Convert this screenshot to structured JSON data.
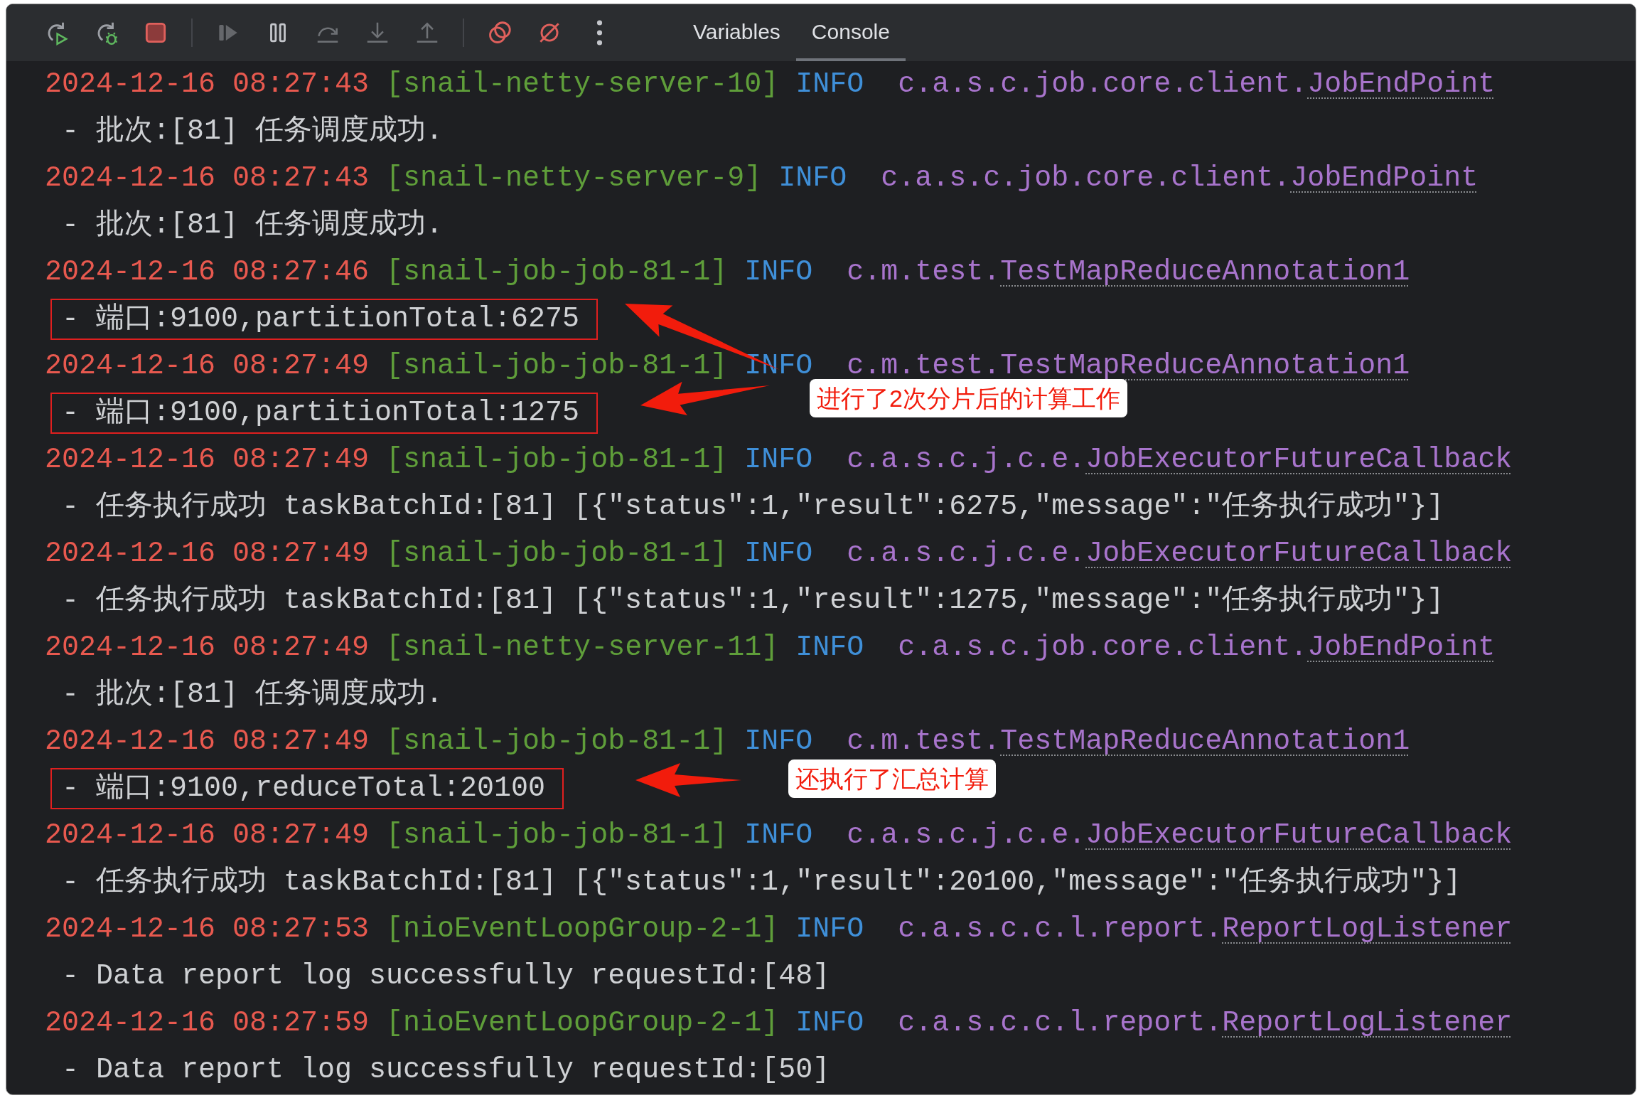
{
  "toolbar": [
    {
      "kind": "rerun",
      "disabled": false
    },
    {
      "kind": "rerun-debug",
      "disabled": false
    },
    {
      "kind": "stop",
      "disabled": false
    },
    {
      "kind": "divider"
    },
    {
      "kind": "resume",
      "disabled": true
    },
    {
      "kind": "pause",
      "disabled": false
    },
    {
      "kind": "step-over",
      "disabled": true
    },
    {
      "kind": "step-into",
      "disabled": true
    },
    {
      "kind": "step-out",
      "disabled": true
    },
    {
      "kind": "divider"
    },
    {
      "kind": "breakpoints",
      "disabled": false
    },
    {
      "kind": "mute",
      "disabled": false
    },
    {
      "kind": "more",
      "disabled": false
    }
  ],
  "tabs": [
    {
      "label": "Variables",
      "selected": false
    },
    {
      "label": "Console",
      "selected": true
    }
  ],
  "log": [
    {
      "time": "2024-12-16 08:27:43",
      "thread": "[snail-netty-server-10]",
      "level": "INFO",
      "logger_prefix": "c.a.s.c.job.core.client.",
      "logger_class": "JobEndPoint",
      "message": "- 批次:[81] 任务调度成功.",
      "boxed": false
    },
    {
      "time": "2024-12-16 08:27:43",
      "thread": "[snail-netty-server-9]",
      "level": "INFO",
      "logger_prefix": "c.a.s.c.job.core.client.",
      "logger_class": "JobEndPoint",
      "message": "- 批次:[81] 任务调度成功.",
      "boxed": false
    },
    {
      "time": "2024-12-16 08:27:46",
      "thread": "[snail-job-job-81-1]",
      "level": "INFO",
      "logger_prefix": "c.m.test.",
      "logger_class": "TestMapReduceAnnotation1",
      "message": "- 端口:9100,partitionTotal:6275",
      "boxed": true
    },
    {
      "time": "2024-12-16 08:27:49",
      "thread": "[snail-job-job-81-1]",
      "level": "INFO",
      "logger_prefix": "c.m.test.",
      "logger_class": "TestMapReduceAnnotation1",
      "message": "- 端口:9100,partitionTotal:1275",
      "boxed": true
    },
    {
      "time": "2024-12-16 08:27:49",
      "thread": "[snail-job-job-81-1]",
      "level": "INFO",
      "logger_prefix": "c.a.s.c.j.c.e.",
      "logger_class": "JobExecutorFutureCallback",
      "message": "- 任务执行成功 taskBatchId:[81] [{\"status\":1,\"result\":6275,\"message\":\"任务执行成功\"}]",
      "boxed": false
    },
    {
      "time": "2024-12-16 08:27:49",
      "thread": "[snail-job-job-81-1]",
      "level": "INFO",
      "logger_prefix": "c.a.s.c.j.c.e.",
      "logger_class": "JobExecutorFutureCallback",
      "message": "- 任务执行成功 taskBatchId:[81] [{\"status\":1,\"result\":1275,\"message\":\"任务执行成功\"}]",
      "boxed": false
    },
    {
      "time": "2024-12-16 08:27:49",
      "thread": "[snail-netty-server-11]",
      "level": "INFO",
      "logger_prefix": "c.a.s.c.job.core.client.",
      "logger_class": "JobEndPoint",
      "message": "- 批次:[81] 任务调度成功.",
      "boxed": false
    },
    {
      "time": "2024-12-16 08:27:49",
      "thread": "[snail-job-job-81-1]",
      "level": "INFO",
      "logger_prefix": "c.m.test.",
      "logger_class": "TestMapReduceAnnotation1",
      "message": "- 端口:9100,reduceTotal:20100",
      "boxed": true
    },
    {
      "time": "2024-12-16 08:27:49",
      "thread": "[snail-job-job-81-1]",
      "level": "INFO",
      "logger_prefix": "c.a.s.c.j.c.e.",
      "logger_class": "JobExecutorFutureCallback",
      "message": "- 任务执行成功 taskBatchId:[81] [{\"status\":1,\"result\":20100,\"message\":\"任务执行成功\"}]",
      "boxed": false
    },
    {
      "time": "2024-12-16 08:27:53",
      "thread": "[nioEventLoopGroup-2-1]",
      "level": "INFO",
      "logger_prefix": "c.a.s.c.c.l.report.",
      "logger_class": "ReportLogListener",
      "message": "- Data report log successfully requestId:[48]",
      "boxed": false
    },
    {
      "time": "2024-12-16 08:27:59",
      "thread": "[nioEventLoopGroup-2-1]",
      "level": "INFO",
      "logger_prefix": "c.a.s.c.c.l.report.",
      "logger_class": "ReportLogListener",
      "message": "- Data report log successfully requestId:[50]",
      "boxed": false
    }
  ],
  "annotations": [
    {
      "text": "进行了2次分片后的计算工作"
    },
    {
      "text": "还执行了汇总计算"
    }
  ]
}
